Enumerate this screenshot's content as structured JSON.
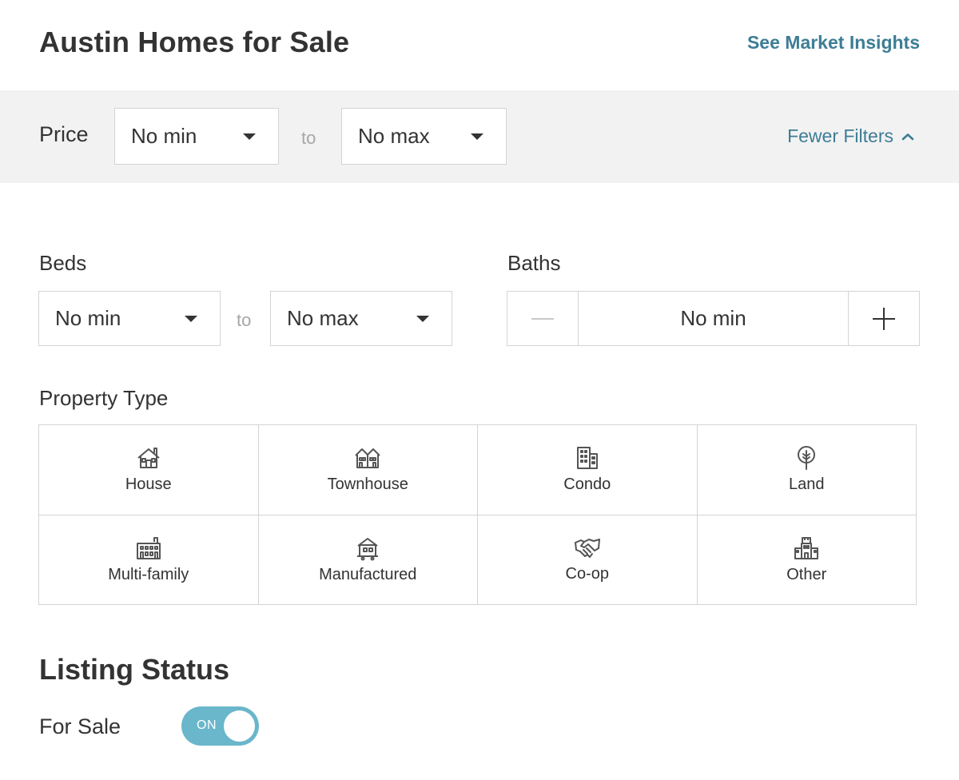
{
  "header": {
    "title": "Austin Homes for Sale",
    "insights_link": "See Market Insights"
  },
  "price": {
    "label": "Price",
    "min": "No min",
    "to": "to",
    "max": "No max",
    "fewer_filters": "Fewer Filters"
  },
  "beds": {
    "label": "Beds",
    "min": "No min",
    "to": "to",
    "max": "No max"
  },
  "baths": {
    "label": "Baths",
    "value": "No min"
  },
  "property_type": {
    "label": "Property Type",
    "items": [
      {
        "label": "House",
        "icon": "house-icon"
      },
      {
        "label": "Townhouse",
        "icon": "townhouse-icon"
      },
      {
        "label": "Condo",
        "icon": "condo-icon"
      },
      {
        "label": "Land",
        "icon": "land-icon"
      },
      {
        "label": "Multi-family",
        "icon": "multi-family-icon"
      },
      {
        "label": "Manufactured",
        "icon": "manufactured-icon"
      },
      {
        "label": "Co-op",
        "icon": "co-op-icon"
      },
      {
        "label": "Other",
        "icon": "other-icon"
      }
    ]
  },
  "listing_status": {
    "title": "Listing Status",
    "for_sale_label": "For Sale",
    "toggle_text": "ON"
  },
  "colors": {
    "link": "#3d7d95",
    "toggle_on": "#6ab6cb",
    "filter_band": "#f2f2f2",
    "border": "#d4d4d4"
  }
}
